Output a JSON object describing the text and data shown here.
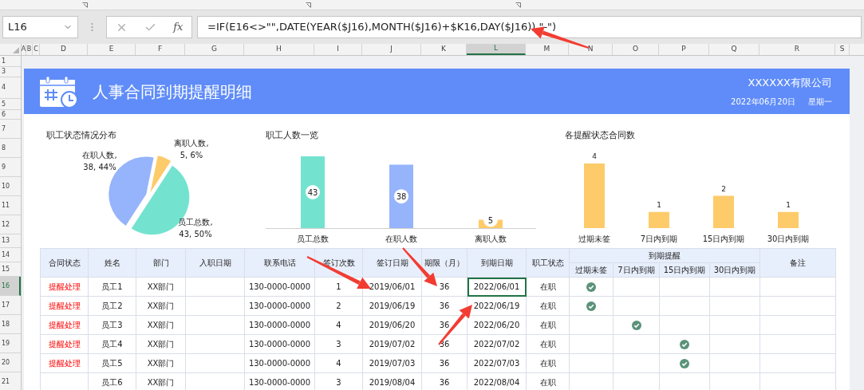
{
  "formula_bar": {
    "name_box": "L16",
    "insert_function": "fx",
    "formula": "=IF(E16<>\"\",DATE(YEAR($J16),MONTH($J16)+$K16,DAY($J16)),\"-\")"
  },
  "column_headers": [
    {
      "label": "A",
      "selected": false
    },
    {
      "label": "B",
      "selected": false
    },
    {
      "label": "C",
      "selected": false
    },
    {
      "label": "D",
      "selected": false
    },
    {
      "label": "E",
      "selected": false
    },
    {
      "label": "F",
      "selected": false
    },
    {
      "label": "G",
      "selected": false
    },
    {
      "label": "H",
      "selected": false
    },
    {
      "label": "I",
      "selected": false
    },
    {
      "label": "J",
      "selected": false
    },
    {
      "label": "K",
      "selected": false
    },
    {
      "label": "L",
      "selected": true
    },
    {
      "label": "M",
      "selected": false
    },
    {
      "label": "N",
      "selected": false
    },
    {
      "label": "O",
      "selected": false
    },
    {
      "label": "P",
      "selected": false
    },
    {
      "label": "Q",
      "selected": false
    },
    {
      "label": "R",
      "selected": false
    },
    {
      "label": "S",
      "selected": false
    }
  ],
  "row_headers": [
    {
      "label": "1",
      "selected": false
    },
    {
      "label": "3",
      "selected": false
    },
    {
      "label": "4",
      "selected": false
    },
    {
      "label": "5",
      "selected": false
    },
    {
      "label": "6",
      "selected": false
    },
    {
      "label": "7",
      "selected": false
    },
    {
      "label": "8",
      "selected": false
    },
    {
      "label": "9",
      "selected": false
    },
    {
      "label": "10",
      "selected": false
    },
    {
      "label": "11",
      "selected": false
    },
    {
      "label": "12",
      "selected": false
    },
    {
      "label": "13",
      "selected": false
    },
    {
      "label": "14",
      "selected": false
    },
    {
      "label": "15",
      "selected": false
    },
    {
      "label": "16",
      "selected": true
    },
    {
      "label": "17",
      "selected": false
    },
    {
      "label": "18",
      "selected": false
    },
    {
      "label": "19",
      "selected": false
    },
    {
      "label": "20",
      "selected": false
    },
    {
      "label": "21",
      "selected": false
    }
  ],
  "banner": {
    "title": "人事合同到期提醒明细",
    "company": "XXXXXX有限公司",
    "date": "2022年06月20日",
    "weekday": "星期一"
  },
  "charts": [
    {
      "title": "职工状态情况分布",
      "chart_data": {
        "type": "pie",
        "values": [
          50,
          44,
          6
        ],
        "colors": [
          "#73e3cf",
          "#96b4fb",
          "#fecb6a"
        ],
        "value_labels": [
          [
            "员工总数,",
            "43, 50%"
          ],
          [
            "在职人数,",
            "38, 44%"
          ],
          [
            "离职人数,",
            "5, 6%"
          ]
        ]
      }
    },
    {
      "title": "职工人数一览",
      "chart_data": {
        "type": "bar",
        "categories": [
          "员工总数",
          "在职人数",
          "离职人数"
        ],
        "series": [
          {
            "colors": [
              "#73e3cf",
              "#96b4fb",
              "#fecb6a"
            ],
            "values": [
              43,
              38,
              5
            ]
          }
        ],
        "data_labels": true
      }
    },
    {
      "title": "各提醒状态合同数",
      "chart_data": {
        "type": "bar",
        "categories": [
          "过期未签",
          "7日内到期",
          "15日内到期",
          "30日内到期"
        ],
        "series": [
          {
            "color": "#fecb6a",
            "values": [
              4,
              1,
              2,
              1
            ]
          }
        ],
        "data_labels": true
      }
    }
  ],
  "table": {
    "columns": [
      "合同状态",
      "姓名",
      "部门",
      "入职日期",
      "联系电话",
      "签订次数",
      "签订日期",
      "期限（月）",
      "到期日期",
      "职工状态"
    ],
    "group": {
      "label": "到期提醒",
      "subcolumns": [
        "过期未签",
        "7日内到期",
        "15日内到期",
        "30日内到期"
      ]
    },
    "last_column": "备注",
    "rows": [
      {
        "status": "提醒处理",
        "name": "员工1",
        "dept": "XX部门",
        "phone": "130-0000-0000",
        "sign_count": "1",
        "sign_date": "2019/06/01",
        "term": "36",
        "due_date": "2022/06/01",
        "due_selected": true,
        "employee_status": "在职",
        "reminders": [
          true,
          false,
          false,
          false
        ]
      },
      {
        "status": "提醒处理",
        "name": "员工2",
        "dept": "XX部门",
        "phone": "130-0000-0000",
        "sign_count": "2",
        "sign_date": "2019/06/19",
        "term": "36",
        "due_date": "2022/06/19",
        "due_selected": false,
        "employee_status": "在职",
        "reminders": [
          true,
          false,
          false,
          false
        ]
      },
      {
        "status": "提醒处理",
        "name": "员工3",
        "dept": "XX部门",
        "phone": "130-0000-0000",
        "sign_count": "4",
        "sign_date": "2019/06/20",
        "term": "36",
        "due_date": "2022/06/20",
        "due_selected": false,
        "employee_status": "在职",
        "reminders": [
          false,
          true,
          false,
          false
        ]
      },
      {
        "status": "提醒处理",
        "name": "员工4",
        "dept": "XX部门",
        "phone": "130-0000-0000",
        "sign_count": "3",
        "sign_date": "2019/07/02",
        "term": "36",
        "due_date": "2022/07/02",
        "due_selected": false,
        "employee_status": "在职",
        "reminders": [
          false,
          false,
          true,
          false
        ]
      },
      {
        "status": "提醒处理",
        "name": "员工5",
        "dept": "XX部门",
        "phone": "130-0000-0000",
        "sign_count": "4",
        "sign_date": "2019/07/03",
        "term": "36",
        "due_date": "2022/07/03",
        "due_selected": false,
        "employee_status": "在职",
        "reminders": [
          false,
          false,
          true,
          false
        ]
      },
      {
        "name": "员工6",
        "dept": "XX部门",
        "phone": "130-0000-0000",
        "sign_count": "3",
        "sign_date": "2019/08/04",
        "term": "36",
        "due_date": "2022/08/04",
        "due_selected": false,
        "employee_status": "在职",
        "reminders": [
          false,
          false,
          false,
          false
        ]
      }
    ]
  }
}
